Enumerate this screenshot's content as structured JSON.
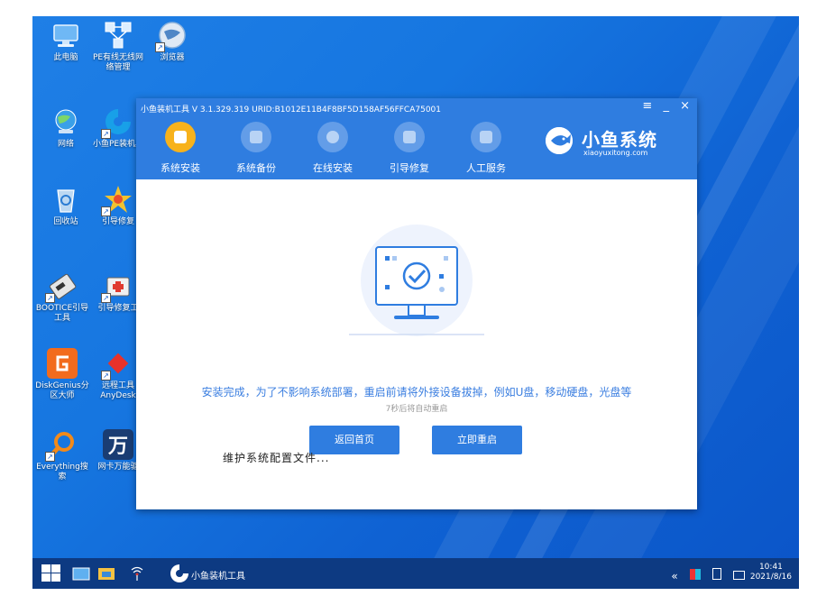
{
  "desktop": {
    "icons": [
      {
        "label": "此电脑",
        "icon": "computer-icon"
      },
      {
        "label": "PE有线无线网络管理",
        "icon": "network-manager-icon"
      },
      {
        "label": "浏览器",
        "icon": "browser-icon"
      },
      {
        "label": "网络",
        "icon": "network-globe-icon"
      },
      {
        "label": "小鱼PE装机具",
        "icon": "xiaoyu-installer-icon"
      },
      {
        "label": "回收站",
        "icon": "recycle-bin-icon"
      },
      {
        "label": "引导修复",
        "icon": "boot-repair-icon"
      },
      {
        "label": "BOOTICE引导工具",
        "icon": "bootice-icon"
      },
      {
        "label": "引导修复工",
        "icon": "boot-repair-tool-icon"
      },
      {
        "label": "DiskGenius分区大师",
        "icon": "diskgenius-icon"
      },
      {
        "label": "远程工具AnyDesk",
        "icon": "anydesk-icon"
      },
      {
        "label": "Everything搜索",
        "icon": "everything-search-icon"
      },
      {
        "label": "网卡万能驱",
        "icon": "nic-driver-icon"
      }
    ]
  },
  "window": {
    "title": "小鱼装机工具 V 3.1.329.319 URID:B1012E11B4F8BF5D158AF56FFCA75001",
    "controls": {
      "menu": "≡",
      "minimize": "_",
      "close": "×"
    },
    "tabs": [
      {
        "label": "系统安装",
        "icon": "system-install-icon"
      },
      {
        "label": "系统备份",
        "icon": "system-backup-icon"
      },
      {
        "label": "在线安装",
        "icon": "online-install-icon"
      },
      {
        "label": "引导修复",
        "icon": "boot-repair-icon"
      },
      {
        "label": "人工服务",
        "icon": "customer-service-icon"
      }
    ],
    "brand": {
      "name": "小鱼系统",
      "url": "xiaoyuxitong.com"
    },
    "content": {
      "message": "安装完成，为了不影响系统部署，重启前请将外接设备拔掉，例如U盘，移动硬盘，光盘等",
      "countdown": "7秒后将自动重启",
      "home_button": "返回首页",
      "restart_button": "立即重启",
      "overlay_text": "维护系统配置文件..."
    }
  },
  "taskbar": {
    "app_label": "小鱼装机工具",
    "clock_time": "10:41",
    "clock_date": "2021/8/16"
  },
  "colors": {
    "accent": "#2f7de0",
    "active_tab": "#f7b21c",
    "message": "#3a7ee0",
    "taskbar": "#0d3a82"
  }
}
